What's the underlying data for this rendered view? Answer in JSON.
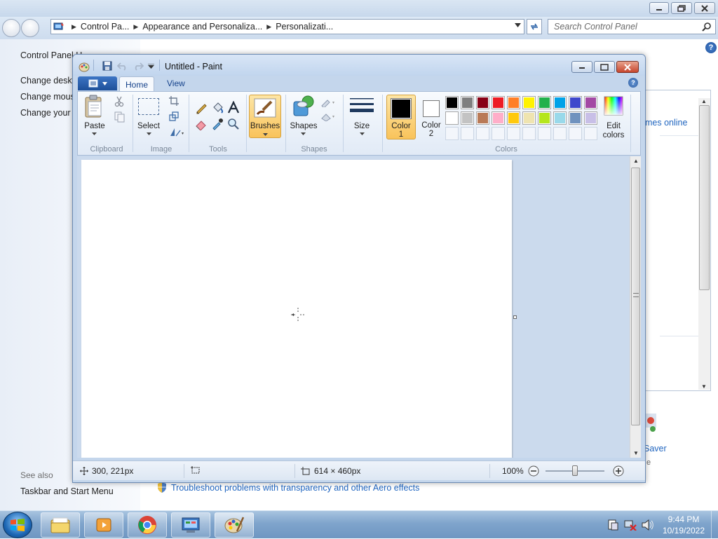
{
  "control_panel": {
    "breadcrumb": [
      "Control Pa...",
      "Appearance and Personaliza...",
      "Personalizati..."
    ],
    "search_placeholder": "Search Control Panel",
    "left_title": "Control Panel H",
    "left_links": [
      "Change deskt",
      "Change mous",
      "Change your a"
    ],
    "see_also": "See also",
    "taskbar_link": "Taskbar and Start Menu",
    "trouble_link": "Troubleshoot problems with transparency and other Aero effects",
    "themes_link": "mes online",
    "saver_link": "Saver",
    "saver_sub": "e"
  },
  "paint": {
    "title": "Untitled - Paint",
    "tabs": {
      "home": "Home",
      "view": "View"
    },
    "ribbon": {
      "paste": "Paste",
      "clipboard": "Clipboard",
      "select": "Select",
      "image": "Image",
      "tools": "Tools",
      "brushes": "Brushes",
      "shapes_btn": "Shapes",
      "shapes_group": "Shapes",
      "size": "Size",
      "color1_a": "Color",
      "color1_b": "1",
      "color2_a": "Color",
      "color2_b": "2",
      "edit_a": "Edit",
      "edit_b": "colors",
      "colors": "Colors"
    },
    "palette_row1": [
      "#000000",
      "#7f7f7f",
      "#880015",
      "#ed1c24",
      "#ff7f27",
      "#fff200",
      "#22b14c",
      "#00a2e8",
      "#3f48cc",
      "#a349a4"
    ],
    "palette_row2": [
      "#ffffff",
      "#c3c3c3",
      "#b97a57",
      "#ffaec9",
      "#ffc90e",
      "#efe4b0",
      "#b5e61d",
      "#99d9ea",
      "#7092be",
      "#c8bfe7"
    ],
    "color1": "#000000",
    "color2": "#ffffff",
    "status": {
      "cursor": "300, 221px",
      "size": "614 × 460px",
      "zoom": "100%"
    }
  },
  "taskbar": {
    "time": "9:44 PM",
    "date": "10/19/2022"
  }
}
